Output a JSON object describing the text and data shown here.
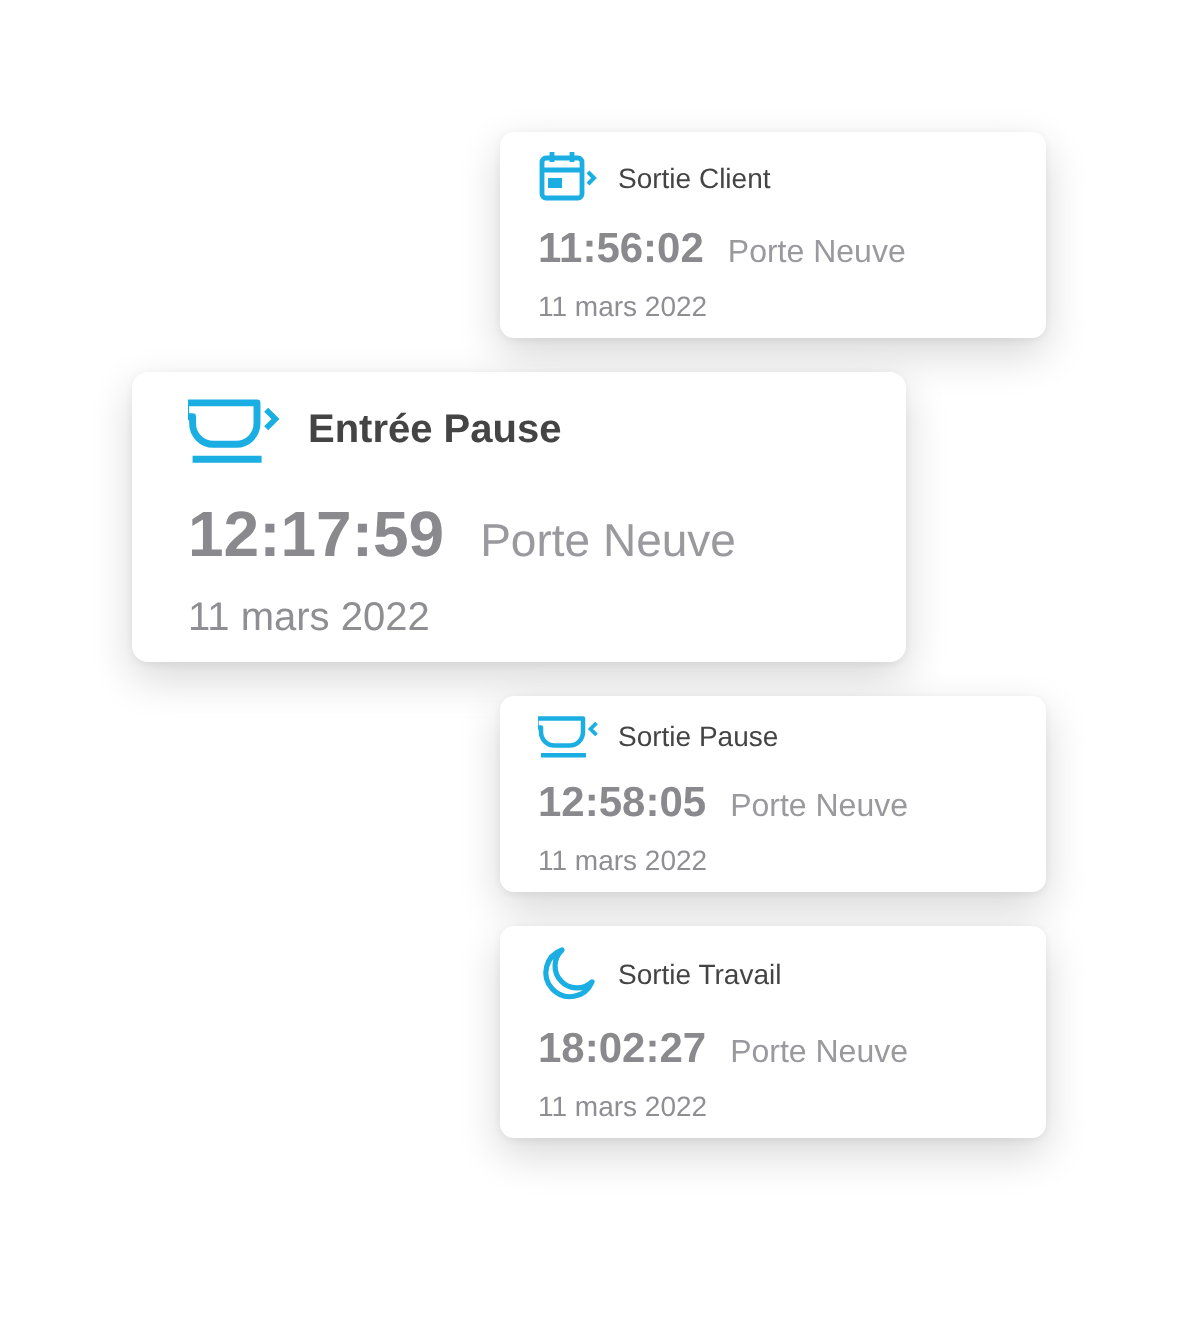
{
  "events": [
    {
      "kind": "client-exit",
      "featured": false,
      "title": "Sortie Client",
      "time": "11:56:02",
      "place": "Porte Neuve",
      "date": "11 mars 2022"
    },
    {
      "kind": "break-start",
      "featured": true,
      "title": "Entrée Pause",
      "time": "12:17:59",
      "place": "Porte Neuve",
      "date": "11 mars 2022"
    },
    {
      "kind": "break-end",
      "featured": false,
      "title": "Sortie Pause",
      "time": "12:58:05",
      "place": "Porte Neuve",
      "date": "11 mars 2022"
    },
    {
      "kind": "work-exit",
      "featured": false,
      "title": "Sortie Travail",
      "time": "18:02:27",
      "place": "Porte Neuve",
      "date": "11 mars 2022"
    }
  ]
}
